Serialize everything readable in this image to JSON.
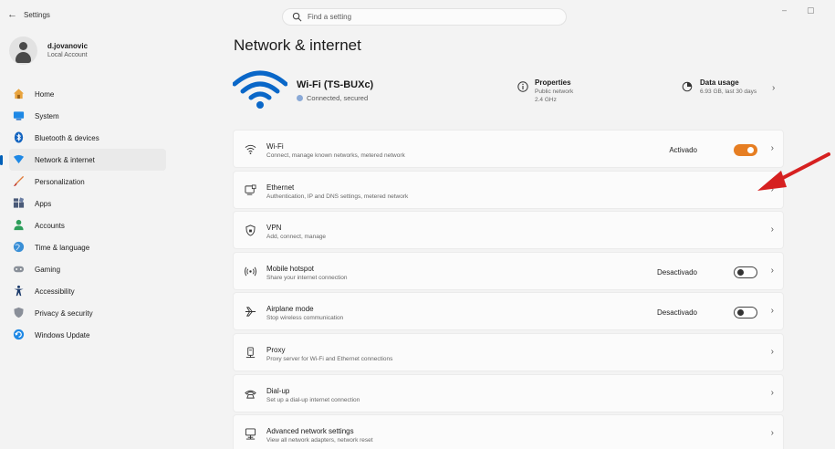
{
  "app": {
    "title": "Settings",
    "back_glyph": "←"
  },
  "search": {
    "placeholder": "Find a setting"
  },
  "window_controls": {
    "minimize": "–",
    "maximize": "▢"
  },
  "user": {
    "name": "d.jovanovic",
    "account_type": "Local Account"
  },
  "sidebar": {
    "items": [
      {
        "label": "Home",
        "icon": "home-icon",
        "color": "#e8a33d",
        "active": false
      },
      {
        "label": "System",
        "icon": "system-icon",
        "color": "#1e88e5",
        "active": false
      },
      {
        "label": "Bluetooth & devices",
        "icon": "bluetooth-icon",
        "color": "#1565c0",
        "active": false
      },
      {
        "label": "Network & internet",
        "icon": "network-icon",
        "color": "#1e88e5",
        "active": true
      },
      {
        "label": "Personalization",
        "icon": "brush-icon",
        "color": "#e07b39",
        "active": false
      },
      {
        "label": "Apps",
        "icon": "apps-icon",
        "color": "#4a5a78",
        "active": false
      },
      {
        "label": "Accounts",
        "icon": "accounts-icon",
        "color": "#2e9e5b",
        "active": false
      },
      {
        "label": "Time & language",
        "icon": "globe-icon",
        "color": "#3a8fd6",
        "active": false
      },
      {
        "label": "Gaming",
        "icon": "gamepad-icon",
        "color": "#8a9099",
        "active": false
      },
      {
        "label": "Accessibility",
        "icon": "accessibility-icon",
        "color": "#1b3a6b",
        "active": false
      },
      {
        "label": "Privacy & security",
        "icon": "shield-icon",
        "color": "#8a8f99",
        "active": false
      },
      {
        "label": "Windows Update",
        "icon": "update-icon",
        "color": "#1e88e5",
        "active": false
      }
    ]
  },
  "main": {
    "title": "Network & internet",
    "hero": {
      "network_name": "Wi-Fi (TS-BUXc)",
      "status": "Connected, secured",
      "properties": {
        "title": "Properties",
        "line1": "Public network",
        "line2": "2.4 GHz"
      },
      "data_usage": {
        "title": "Data usage",
        "line1": "6.93 GB, last 30 days"
      }
    },
    "cards": [
      {
        "title": "Wi-Fi",
        "subtitle": "Connect, manage known networks, metered network",
        "icon": "wifi-icon",
        "state": "Activado",
        "toggle": "on"
      },
      {
        "title": "Ethernet",
        "subtitle": "Authentication, IP and DNS settings, metered network",
        "icon": "ethernet-icon",
        "state": "",
        "toggle": ""
      },
      {
        "title": "VPN",
        "subtitle": "Add, connect, manage",
        "icon": "vpn-shield-icon",
        "state": "",
        "toggle": ""
      },
      {
        "title": "Mobile hotspot",
        "subtitle": "Share your internet connection",
        "icon": "hotspot-icon",
        "state": "Desactivado",
        "toggle": "off"
      },
      {
        "title": "Airplane mode",
        "subtitle": "Stop wireless communication",
        "icon": "airplane-icon",
        "state": "Desactivado",
        "toggle": "off"
      },
      {
        "title": "Proxy",
        "subtitle": "Proxy server for Wi-Fi and Ethernet connections",
        "icon": "proxy-icon",
        "state": "",
        "toggle": ""
      },
      {
        "title": "Dial-up",
        "subtitle": "Set up a dial-up internet connection",
        "icon": "dialup-icon",
        "state": "",
        "toggle": ""
      },
      {
        "title": "Advanced network settings",
        "subtitle": "View all network adapters, network reset",
        "icon": "advanced-network-icon",
        "state": "",
        "toggle": ""
      }
    ],
    "chevron": "›"
  },
  "colors": {
    "accent": "#005fb8",
    "toggle_on": "#e67e22",
    "annotation_arrow": "#d62020",
    "wifi_hero": "#0a67c8"
  }
}
